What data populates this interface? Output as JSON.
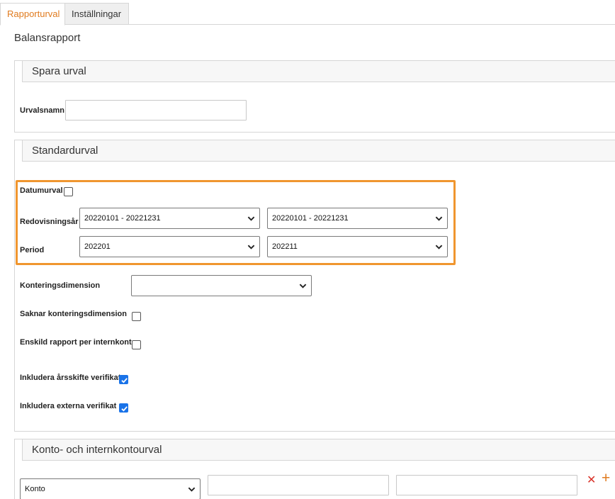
{
  "tabs": [
    {
      "label": "Rapporturval",
      "active": true
    },
    {
      "label": "Inställningar",
      "active": false
    }
  ],
  "page_title": "Balansrapport",
  "sections": {
    "spara_urval": {
      "title": "Spara urval",
      "urvalsnamn_label": "Urvalsnamn",
      "urvalsnamn_value": ""
    },
    "standardurval": {
      "title": "Standardurval",
      "datumurval_label": "Datumurval",
      "datumurval_checked": false,
      "redovisningsar_label": "Redovisningsår",
      "redovisningsar_from": "20220101 - 20221231",
      "redovisningsar_to": "20220101 - 20221231",
      "period_label": "Period",
      "period_from": "202201",
      "period_to": "202211",
      "konteringsdimension_label": "Konteringsdimension",
      "konteringsdimension_value": "",
      "saknar_label": "Saknar konteringsdimension",
      "saknar_checked": false,
      "enskild_label": "Enskild rapport per internkonto",
      "enskild_checked": false,
      "arsskifte_label": "Inkludera årsskifte verifikat",
      "arsskifte_checked": true,
      "externa_label": "Inkludera externa verifikat",
      "externa_checked": true
    },
    "konto": {
      "title": "Konto- och internkontourval",
      "type_value": "Konto",
      "from_value": "",
      "to_value": "",
      "remove_glyph": "✕",
      "add_glyph": "+"
    }
  },
  "colors": {
    "accent_orange": "#f0962f",
    "tab_active_text": "#e07b1f",
    "checkbox_checked": "#1a73e8",
    "remove_red": "#d9342b",
    "add_orange": "#e07b1f"
  }
}
